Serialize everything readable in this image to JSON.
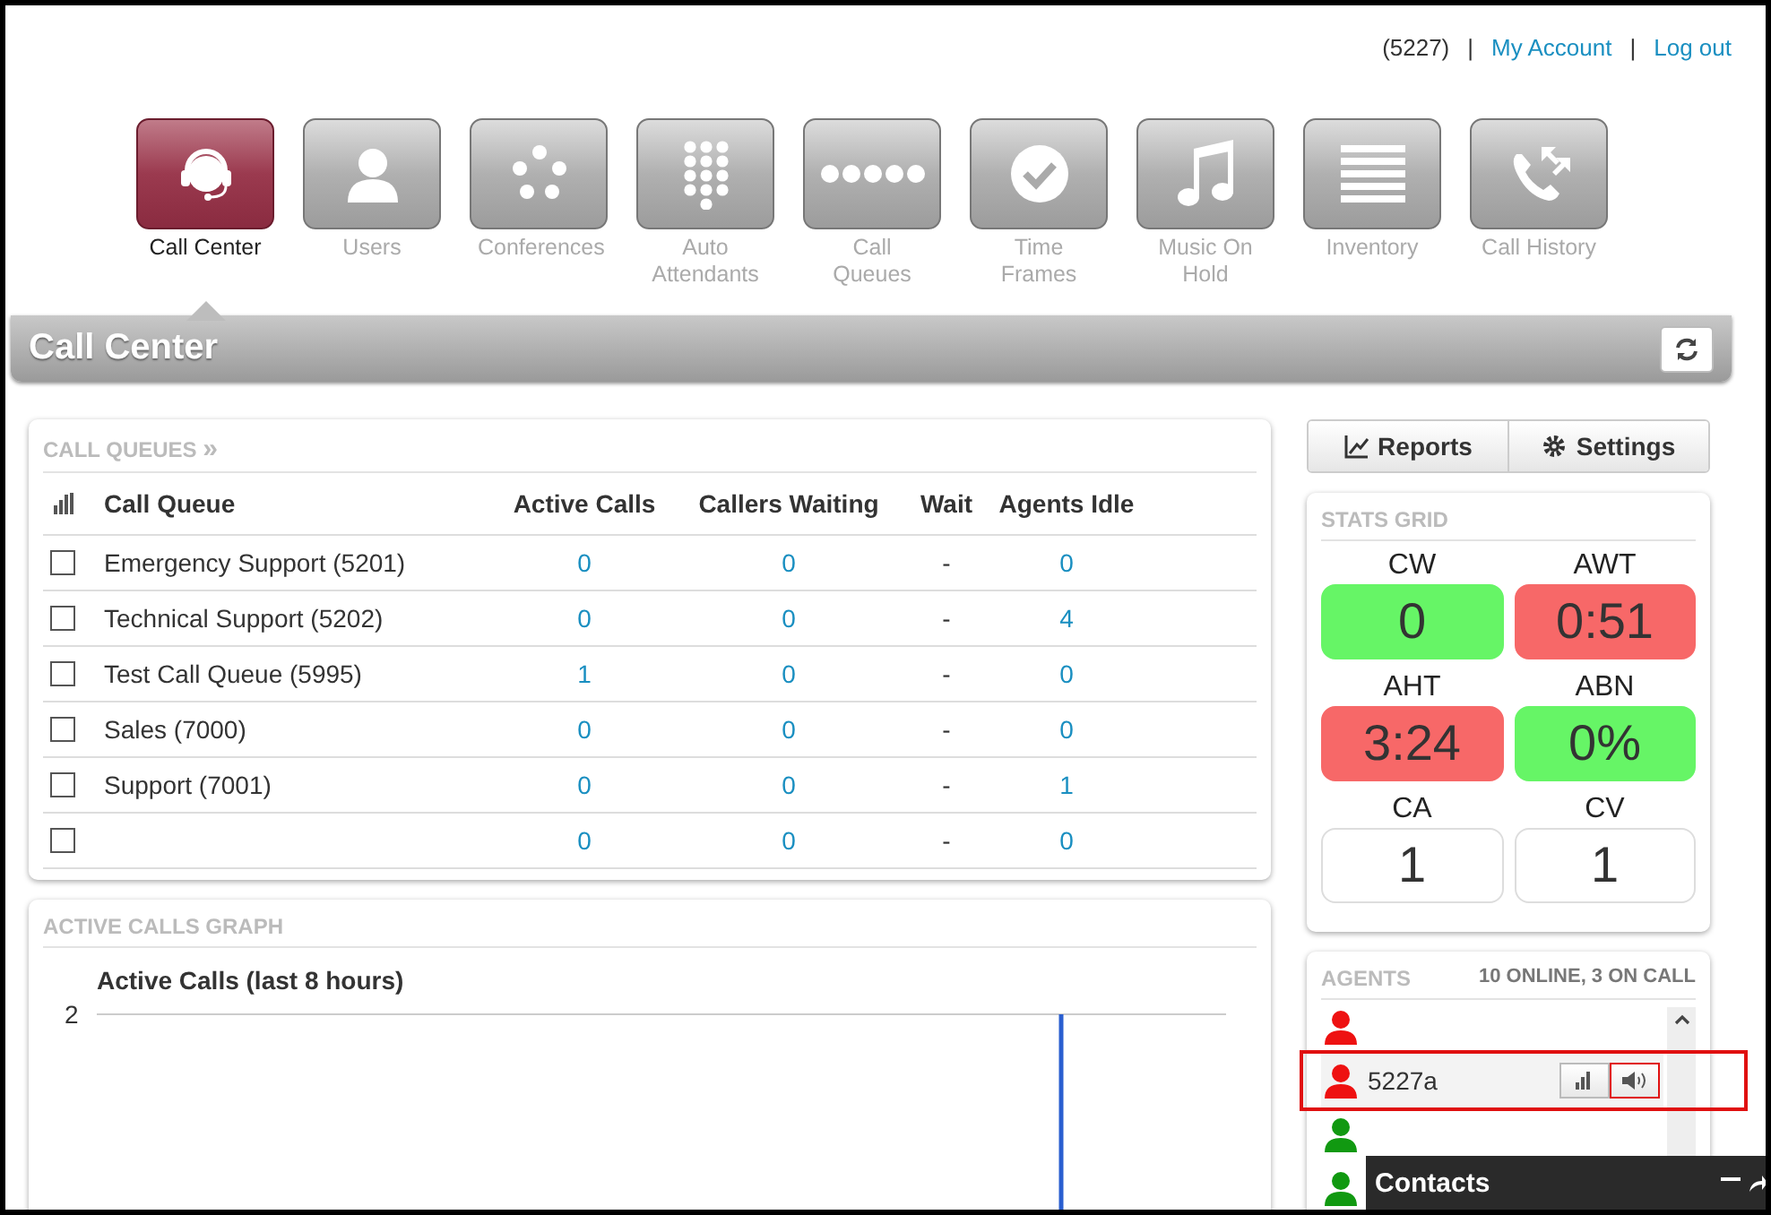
{
  "header": {
    "extension": "(5227)",
    "separator": "|",
    "links": [
      "My Account",
      "Log out"
    ]
  },
  "nav": [
    {
      "label": "Call Center",
      "selected": true
    },
    {
      "label": "Users",
      "selected": false
    },
    {
      "label": "Conferences",
      "selected": false
    },
    {
      "label": "Auto Attendants",
      "selected": false
    },
    {
      "label": "Call Queues",
      "selected": false
    },
    {
      "label": "Time Frames",
      "selected": false
    },
    {
      "label": "Music On Hold",
      "selected": false
    },
    {
      "label": "Inventory",
      "selected": false
    },
    {
      "label": "Call History",
      "selected": false
    }
  ],
  "banner": {
    "title": "Call Center"
  },
  "call_queues": {
    "title": "CALL QUEUES",
    "title_mark": "»",
    "columns": [
      "Call Queue",
      "Active Calls",
      "Callers Waiting",
      "Wait",
      "Agents Idle"
    ],
    "rows": [
      {
        "checked": false,
        "cells": [
          "Emergency Support (5201)",
          "0",
          "0",
          "-",
          "0"
        ]
      },
      {
        "checked": false,
        "cells": [
          "Technical Support (5202)",
          "0",
          "0",
          "-",
          "4"
        ]
      },
      {
        "checked": false,
        "cells": [
          "Test Call Queue (5995)",
          "1",
          "0",
          "-",
          "0"
        ]
      },
      {
        "checked": false,
        "cells": [
          "Sales (7000)",
          "0",
          "0",
          "-",
          "0"
        ]
      },
      {
        "checked": false,
        "cells": [
          "Support (7001)",
          "0",
          "0",
          "-",
          "1"
        ]
      },
      {
        "checked": false,
        "cells": [
          "",
          "0",
          "0",
          "-",
          "0"
        ]
      }
    ]
  },
  "graph": {
    "title": "ACTIVE CALLS GRAPH",
    "chart_title": "Active Calls (last 8 hours)",
    "tick_label": "2"
  },
  "buttons": [
    "Reports",
    "Settings"
  ],
  "stats": {
    "title": "STATS GRID",
    "cells": [
      {
        "label": "CW",
        "value": "0",
        "color": "#66f566"
      },
      {
        "label": "AWT",
        "value": "0:51",
        "color": "#f76868"
      },
      {
        "label": "AHT",
        "value": "3:24",
        "color": "#f76868"
      },
      {
        "label": "ABN",
        "value": "0%",
        "color": "#66f566"
      },
      {
        "label": "CA",
        "value": "1",
        "color": "#ffffff"
      },
      {
        "label": "CV",
        "value": "1",
        "color": "#ffffff"
      }
    ]
  },
  "agents": {
    "title": "AGENTS",
    "summary": "10 ONLINE, 3 ON CALL",
    "items": [
      {
        "color": "#ee1111",
        "highlighted": false
      },
      {
        "name": "5227a",
        "color": "#ee1111",
        "highlighted": true
      },
      {
        "color": "#119911",
        "highlighted": false
      },
      {
        "color": "#119911",
        "highlighted": false
      }
    ]
  },
  "contacts": {
    "title": "Contacts"
  }
}
